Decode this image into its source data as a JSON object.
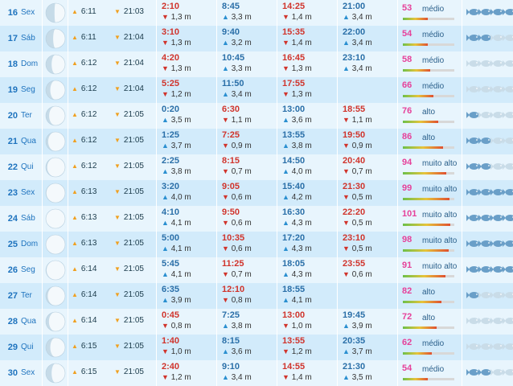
{
  "units": {
    "meter": "m"
  },
  "colors": {
    "fish_active": "#6a9fc8",
    "fish_inactive": "#c9dce8"
  },
  "rows": [
    {
      "day": "16",
      "weekday": "Sex",
      "moon_phase": 0.55,
      "sunrise": "6:11",
      "sunset": "21:03",
      "tides": [
        {
          "type": "low",
          "time": "2:10",
          "height": "1,3"
        },
        {
          "type": "high",
          "time": "8:45",
          "height": "3,3"
        },
        {
          "type": "low",
          "time": "14:25",
          "height": "1,4"
        },
        {
          "type": "high",
          "time": "21:00",
          "height": "3,4"
        }
      ],
      "coef": "53",
      "coef_label": "médio",
      "coef_fraction": 0.48,
      "fish": [
        1,
        1,
        1,
        1
      ]
    },
    {
      "day": "17",
      "weekday": "Sáb",
      "moon_phase": 0.62,
      "sunrise": "6:11",
      "sunset": "21:04",
      "tides": [
        {
          "type": "low",
          "time": "3:10",
          "height": "1,3"
        },
        {
          "type": "high",
          "time": "9:40",
          "height": "3,2"
        },
        {
          "type": "low",
          "time": "15:35",
          "height": "1,4"
        },
        {
          "type": "high",
          "time": "22:00",
          "height": "3,4"
        }
      ],
      "coef": "54",
      "coef_label": "médio",
      "coef_fraction": 0.49,
      "fish": [
        1,
        1,
        0,
        0
      ]
    },
    {
      "day": "18",
      "weekday": "Dom",
      "moon_phase": 0.7,
      "sunrise": "6:12",
      "sunset": "21:04",
      "tides": [
        {
          "type": "low",
          "time": "4:20",
          "height": "1,3"
        },
        {
          "type": "high",
          "time": "10:45",
          "height": "3,3"
        },
        {
          "type": "low",
          "time": "16:45",
          "height": "1,3"
        },
        {
          "type": "high",
          "time": "23:10",
          "height": "3,4"
        }
      ],
      "coef": "58",
      "coef_label": "médio",
      "coef_fraction": 0.53,
      "fish": [
        0,
        0,
        0,
        0
      ]
    },
    {
      "day": "19",
      "weekday": "Seg",
      "moon_phase": 0.77,
      "sunrise": "6:12",
      "sunset": "21:04",
      "tides": [
        {
          "type": "low",
          "time": "5:25",
          "height": "1,2"
        },
        {
          "type": "high",
          "time": "11:50",
          "height": "3,4"
        },
        {
          "type": "low",
          "time": "17:55",
          "height": "1,3"
        },
        {
          "type": "none",
          "time": "",
          "height": ""
        }
      ],
      "coef": "66",
      "coef_label": "médio",
      "coef_fraction": 0.6,
      "fish": [
        0,
        0,
        0,
        0
      ]
    },
    {
      "day": "20",
      "weekday": "Ter",
      "moon_phase": 0.83,
      "sunrise": "6:12",
      "sunset": "21:05",
      "tides": [
        {
          "type": "high",
          "time": "0:20",
          "height": "3,5"
        },
        {
          "type": "low",
          "time": "6:30",
          "height": "1,1"
        },
        {
          "type": "high",
          "time": "13:00",
          "height": "3,6"
        },
        {
          "type": "low",
          "time": "18:55",
          "height": "1,1"
        }
      ],
      "coef": "76",
      "coef_label": "alto",
      "coef_fraction": 0.69,
      "fish": [
        1,
        0,
        0,
        0
      ]
    },
    {
      "day": "21",
      "weekday": "Qua",
      "moon_phase": 0.88,
      "sunrise": "6:12",
      "sunset": "21:05",
      "tides": [
        {
          "type": "high",
          "time": "1:25",
          "height": "3,7"
        },
        {
          "type": "low",
          "time": "7:25",
          "height": "0,9"
        },
        {
          "type": "high",
          "time": "13:55",
          "height": "3,8"
        },
        {
          "type": "low",
          "time": "19:50",
          "height": "0,9"
        }
      ],
      "coef": "86",
      "coef_label": "alto",
      "coef_fraction": 0.78,
      "fish": [
        1,
        1,
        0,
        0
      ]
    },
    {
      "day": "22",
      "weekday": "Qui",
      "moon_phase": 0.93,
      "sunrise": "6:12",
      "sunset": "21:05",
      "tides": [
        {
          "type": "high",
          "time": "2:25",
          "height": "3,8"
        },
        {
          "type": "low",
          "time": "8:15",
          "height": "0,7"
        },
        {
          "type": "high",
          "time": "14:50",
          "height": "4,0"
        },
        {
          "type": "low",
          "time": "20:40",
          "height": "0,7"
        }
      ],
      "coef": "94",
      "coef_label": "muito alto",
      "coef_fraction": 0.85,
      "fish": [
        1,
        1,
        0,
        0
      ]
    },
    {
      "day": "23",
      "weekday": "Sex",
      "moon_phase": 0.97,
      "sunrise": "6:13",
      "sunset": "21:05",
      "tides": [
        {
          "type": "high",
          "time": "3:20",
          "height": "4,0"
        },
        {
          "type": "low",
          "time": "9:05",
          "height": "0,6"
        },
        {
          "type": "high",
          "time": "15:40",
          "height": "4,2"
        },
        {
          "type": "low",
          "time": "21:30",
          "height": "0,5"
        }
      ],
      "coef": "99",
      "coef_label": "muito alto",
      "coef_fraction": 0.9,
      "fish": [
        1,
        1,
        1,
        1
      ]
    },
    {
      "day": "24",
      "weekday": "Sáb",
      "moon_phase": 1.0,
      "sunrise": "6:13",
      "sunset": "21:05",
      "tides": [
        {
          "type": "high",
          "time": "4:10",
          "height": "4,1"
        },
        {
          "type": "low",
          "time": "9:50",
          "height": "0,6"
        },
        {
          "type": "high",
          "time": "16:30",
          "height": "4,3"
        },
        {
          "type": "low",
          "time": "22:20",
          "height": "0,5"
        }
      ],
      "coef": "101",
      "coef_label": "muito alto",
      "coef_fraction": 0.92,
      "fish": [
        1,
        1,
        1,
        1
      ]
    },
    {
      "day": "25",
      "weekday": "Dom",
      "moon_phase": 1.0,
      "sunrise": "6:13",
      "sunset": "21:05",
      "tides": [
        {
          "type": "high",
          "time": "5:00",
          "height": "4,1"
        },
        {
          "type": "low",
          "time": "10:35",
          "height": "0,6"
        },
        {
          "type": "high",
          "time": "17:20",
          "height": "4,3"
        },
        {
          "type": "low",
          "time": "23:10",
          "height": "0,5"
        }
      ],
      "coef": "98",
      "coef_label": "muito alto",
      "coef_fraction": 0.89,
      "fish": [
        1,
        1,
        1,
        1
      ]
    },
    {
      "day": "26",
      "weekday": "Seg",
      "moon_phase": 0.96,
      "sunrise": "6:14",
      "sunset": "21:05",
      "tides": [
        {
          "type": "high",
          "time": "5:45",
          "height": "4,1"
        },
        {
          "type": "low",
          "time": "11:25",
          "height": "0,7"
        },
        {
          "type": "high",
          "time": "18:05",
          "height": "4,3"
        },
        {
          "type": "low",
          "time": "23:55",
          "height": "0,6"
        }
      ],
      "coef": "91",
      "coef_label": "muito alto",
      "coef_fraction": 0.83,
      "fish": [
        1,
        1,
        1,
        1
      ]
    },
    {
      "day": "27",
      "weekday": "Ter",
      "moon_phase": 0.9,
      "sunrise": "6:14",
      "sunset": "21:05",
      "tides": [
        {
          "type": "high",
          "time": "6:35",
          "height": "3,9"
        },
        {
          "type": "low",
          "time": "12:10",
          "height": "0,8"
        },
        {
          "type": "high",
          "time": "18:55",
          "height": "4,1"
        },
        {
          "type": "none",
          "time": "",
          "height": ""
        }
      ],
      "coef": "82",
      "coef_label": "alto",
      "coef_fraction": 0.75,
      "fish": [
        1,
        0,
        0,
        0
      ]
    },
    {
      "day": "28",
      "weekday": "Qua",
      "moon_phase": 0.84,
      "sunrise": "6:14",
      "sunset": "21:05",
      "tides": [
        {
          "type": "low",
          "time": "0:45",
          "height": "0,8"
        },
        {
          "type": "high",
          "time": "7:25",
          "height": "3,8"
        },
        {
          "type": "low",
          "time": "13:00",
          "height": "1,0"
        },
        {
          "type": "high",
          "time": "19:45",
          "height": "3,9"
        }
      ],
      "coef": "72",
      "coef_label": "alto",
      "coef_fraction": 0.65,
      "fish": [
        0,
        0,
        0,
        0
      ]
    },
    {
      "day": "29",
      "weekday": "Qui",
      "moon_phase": 0.77,
      "sunrise": "6:15",
      "sunset": "21:05",
      "tides": [
        {
          "type": "low",
          "time": "1:40",
          "height": "1,0"
        },
        {
          "type": "high",
          "time": "8:15",
          "height": "3,6"
        },
        {
          "type": "low",
          "time": "13:55",
          "height": "1,2"
        },
        {
          "type": "high",
          "time": "20:35",
          "height": "3,7"
        }
      ],
      "coef": "62",
      "coef_label": "médio",
      "coef_fraction": 0.56,
      "fish": [
        0,
        0,
        0,
        0
      ]
    },
    {
      "day": "30",
      "weekday": "Sex",
      "moon_phase": 0.7,
      "sunrise": "6:15",
      "sunset": "21:05",
      "tides": [
        {
          "type": "low",
          "time": "2:40",
          "height": "1,2"
        },
        {
          "type": "high",
          "time": "9:10",
          "height": "3,4"
        },
        {
          "type": "low",
          "time": "14:55",
          "height": "1,4"
        },
        {
          "type": "high",
          "time": "21:30",
          "height": "3,5"
        }
      ],
      "coef": "54",
      "coef_label": "médio",
      "coef_fraction": 0.49,
      "fish": [
        1,
        1,
        0,
        0
      ]
    }
  ]
}
